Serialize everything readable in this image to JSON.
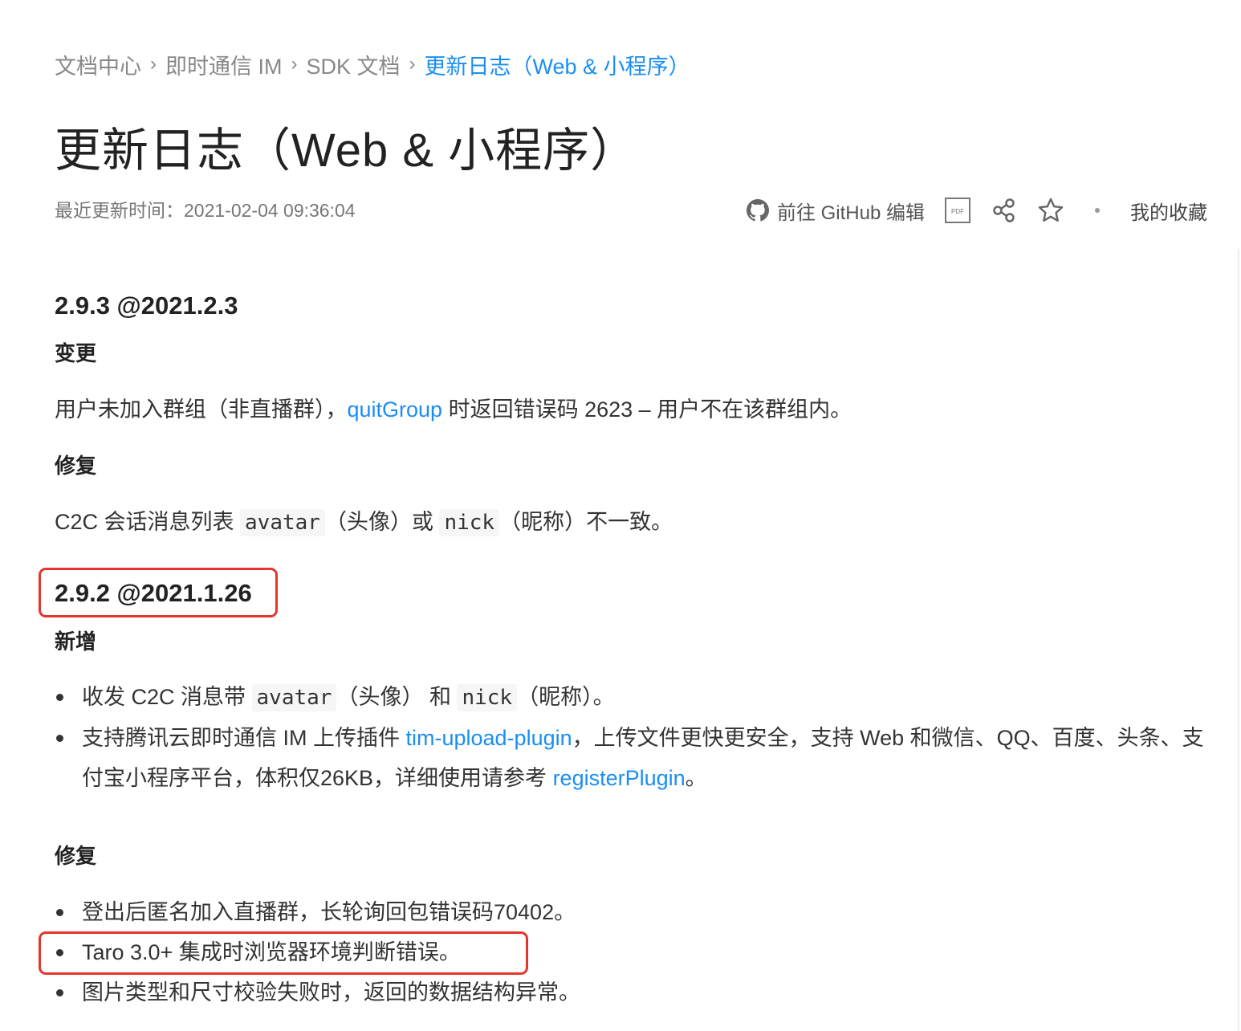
{
  "breadcrumb": {
    "items": [
      "文档中心",
      "即时通信 IM",
      "SDK 文档"
    ],
    "current": "更新日志（Web & 小程序）",
    "separator": "›"
  },
  "title": "更新日志（Web & 小程序）",
  "last_updated": "最近更新时间：2021-02-04 09:36:04",
  "actions": {
    "github_label": "前往 GitHub 编辑",
    "pdf_label": "PDF",
    "favorites_label": "我的收藏"
  },
  "releases": [
    {
      "heading": "2.9.3 @2021.2.3",
      "sections": [
        {
          "title": "变更",
          "line": {
            "before": "用户未加入群组（非直播群），",
            "link": "quitGroup",
            "after": " 时返回错误码 2623 – 用户不在该群组内。"
          }
        },
        {
          "title": "修复",
          "line": {
            "p1": "C2C 会话消息列表 ",
            "code1": "avatar",
            "p2": "（头像）或 ",
            "code2": "nick",
            "p3": "（昵称）不一致。"
          }
        }
      ]
    },
    {
      "heading": "2.9.2 @2021.1.26",
      "sections": [
        {
          "title": "新增",
          "items": [
            {
              "p1": "收发 C2C 消息带 ",
              "code1": "avatar",
              "p2": "（头像） 和 ",
              "code2": "nick",
              "p3": "（昵称）。"
            },
            {
              "p1": "支持腾讯云即时通信 IM 上传插件 ",
              "link1": "tim-upload-plugin",
              "p2": "，上传文件更快更安全，支持 Web 和微信、QQ、百度、头条、支付宝小程序平台，体积仅26KB，详细使用请参考 ",
              "link2": "registerPlugin",
              "p3": "。"
            }
          ]
        },
        {
          "title": "修复",
          "items": [
            "登出后匿名加入直播群，长轮询回包错误码70402。",
            "Taro 3.0+ 集成时浏览器环境判断错误。",
            "图片类型和尺寸校验失败时，返回的数据结构异常。"
          ]
        }
      ]
    }
  ],
  "colors": {
    "link": "#1a8ef5",
    "highlight_box": "#e3362c",
    "text": "#333333",
    "muted": "#888888"
  },
  "icons": [
    "chevron-right-icon",
    "github-icon",
    "pdf-icon",
    "share-icon",
    "star-icon"
  ]
}
